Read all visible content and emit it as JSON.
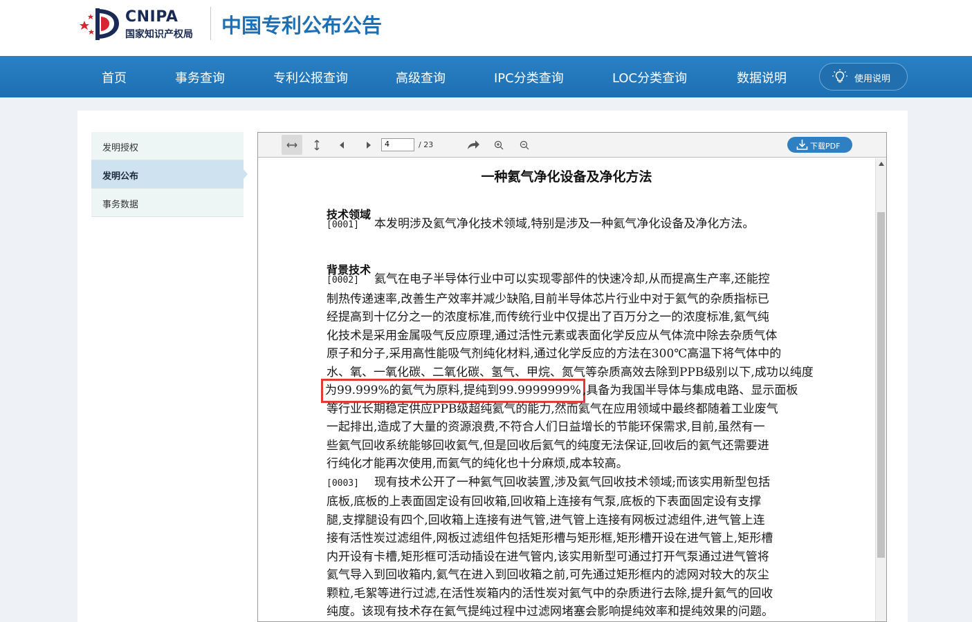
{
  "header": {
    "logo_text": "CNIPA",
    "logo_subtitle": "国家知识产权局",
    "site_title": "中国专利公布公告"
  },
  "nav": {
    "items": [
      "首页",
      "事务查询",
      "专利公报查询",
      "高级查询",
      "IPC分类查询",
      "LOC分类查询",
      "数据说明"
    ],
    "help_label": "使用说明"
  },
  "sidebar": {
    "items": [
      {
        "label": "发明授权",
        "active": false
      },
      {
        "label": "发明公布",
        "active": true
      },
      {
        "label": "事务数据",
        "active": false
      }
    ]
  },
  "viewer": {
    "toolbar": {
      "page_value": "4",
      "page_total": "/ 23",
      "download_label": "下载PDF"
    },
    "document": {
      "title": "一种氦气净化设备及净化方法",
      "sections": [
        {
          "heading": "技术领域"
        },
        {
          "heading": "背景技术"
        }
      ],
      "p0001": {
        "num": "[0001]",
        "lines": [
          "本发明涉及氦气净化技术领域,特别是涉及一种氦气净化设备及净化方法。"
        ]
      },
      "p0002": {
        "num": "[0002]",
        "lines": [
          "氦气在电子半导体行业中可以实现零部件的快速冷却,从而提高生产率,还能控",
          "制热传递速率,改善生产效率并减少缺陷,目前半导体芯片行业中对于氦气的杂质指标已",
          "经提高到十亿分之一的浓度标准,而传统行业中仅提出了百万分之一的浓度标准,氦气纯",
          "化技术是采用金属吸气反应原理,通过活性元素或表面化学反应从气体流中除去杂质气体",
          "原子和分子,采用高性能吸气剂纯化材料,通过化学反应的方法在300℃高温下将气体中的",
          "水、氧、一氧化碳、二氧化碳、氢气、甲烷、氮气等杂质高效去除到PPB级别以下,成功以纯度"
        ],
        "highlight": "为99.999%的氦气为原料,提纯到99.9999999%",
        "after_highlight": ",具备为我国半导体与集成电路、显示面板",
        "rest_lines": [
          "等行业长期稳定供应PPB级超纯氦气的能力,然而氦气在应用领域中最终都随着工业废气",
          "一起排出,造成了大量的资源浪费,不符合人们日益增长的节能环保需求,目前,虽然有一",
          "些氦气回收系统能够回收氦气,但是回收后氦气的纯度无法保证,回收后的氦气还需要进",
          "行纯化才能再次使用,而氦气的纯化也十分麻烦,成本较高。"
        ]
      },
      "p0003": {
        "num": "[0003]",
        "lines": [
          "现有技术公开了一种氦气回收装置,涉及氦气回收技术领域;而该实用新型包括",
          "底板,底板的上表面固定设有回收箱,回收箱上连接有气泵,底板的下表面固定设有支撑",
          "腿,支撑腿设有四个,回收箱上连接有进气管,进气管上连接有网板过滤组件,进气管上连",
          "接有活性炭过滤组件,网板过滤组件包括矩形槽与矩形框,矩形槽开设在进气管上,矩形槽",
          "内开设有卡槽,矩形框可活动插设在进气管内,该实用新型可通过打开气泵通过进气管将",
          "氦气导入到回收箱内,氦气在进入到回收箱之前,可先通过矩形框内的滤网对较大的灰尘",
          "颗粒,毛絮等进行过滤,在活性炭箱内的活性炭对氦气中的杂质进行去除,提升氦气的回收",
          "纯度。该现有技术存在氦气提纯过程中过滤网堵塞会影响提纯效率和提纯效果的问题。"
        ]
      }
    }
  },
  "colors": {
    "nav_bg": "#2378bb",
    "title_blue": "#1f6fb5",
    "highlight_red": "#e53935",
    "download_btn": "#2f7fc3"
  }
}
